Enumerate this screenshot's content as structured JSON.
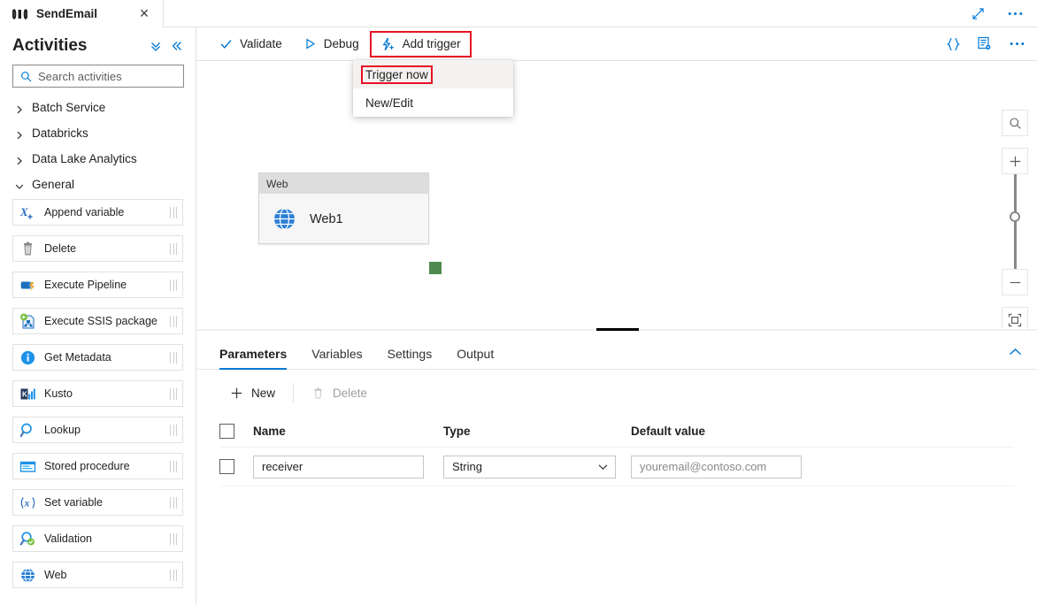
{
  "tab": {
    "icon": "pipeline-icon",
    "title": "SendEmail",
    "close": "✕"
  },
  "window_tools": {
    "maximize": "expand-diagonal-icon",
    "more": "•••"
  },
  "sidebar": {
    "title": "Activities",
    "collapse_all_icon": "double-chevron-down-icon",
    "collapse_panel_icon": "double-chevron-left-icon",
    "search": {
      "placeholder": "Search activities",
      "value": "",
      "icon": "search-icon"
    },
    "categories": [
      {
        "label": "Batch Service",
        "expanded": false
      },
      {
        "label": "Databricks",
        "expanded": false
      },
      {
        "label": "Data Lake Analytics",
        "expanded": false
      },
      {
        "label": "General",
        "expanded": true
      }
    ],
    "activities": [
      {
        "label": "Append variable",
        "icon": "append-variable-icon"
      },
      {
        "label": "Delete",
        "icon": "delete-icon"
      },
      {
        "label": "Execute Pipeline",
        "icon": "execute-pipeline-icon"
      },
      {
        "label": "Execute SSIS package",
        "icon": "execute-ssis-package-icon"
      },
      {
        "label": "Get Metadata",
        "icon": "get-metadata-icon"
      },
      {
        "label": "Kusto",
        "icon": "kusto-icon"
      },
      {
        "label": "Lookup",
        "icon": "lookup-icon"
      },
      {
        "label": "Stored procedure",
        "icon": "stored-procedure-icon"
      },
      {
        "label": "Set variable",
        "icon": "set-variable-icon"
      },
      {
        "label": "Validation",
        "icon": "validation-icon"
      },
      {
        "label": "Web",
        "icon": "web-icon"
      }
    ]
  },
  "toolbar": {
    "validate": {
      "label": "Validate",
      "icon": "checkmark-icon"
    },
    "debug": {
      "label": "Debug",
      "icon": "play-triangle-icon"
    },
    "add_trigger": {
      "label": "Add trigger",
      "icon": "lightning-bolt-plus-icon",
      "highlighted": true
    },
    "code": {
      "icon": "curly-braces-icon"
    },
    "properties": {
      "icon": "properties-list-icon"
    },
    "more": {
      "icon": "ellipsis-icon",
      "label": "•••"
    }
  },
  "trigger_menu": {
    "items": [
      {
        "label": "Trigger now",
        "hovered": true,
        "highlighted": true
      },
      {
        "label": "New/Edit",
        "hovered": false,
        "highlighted": false
      }
    ]
  },
  "canvas": {
    "node": {
      "type_label": "Web",
      "name": "Web1",
      "icon": "globe-icon",
      "output_connector": "success-output-connector"
    },
    "zoom_controls": {
      "search_icon": "zoom-search-icon",
      "zoom_in": "+",
      "zoom_out": "−",
      "fit_icon": "fit-to-screen-icon"
    }
  },
  "bottom_panel": {
    "tabs": [
      {
        "label": "Parameters",
        "active": true
      },
      {
        "label": "Variables",
        "active": false
      },
      {
        "label": "Settings",
        "active": false
      },
      {
        "label": "Output",
        "active": false
      }
    ],
    "collapse_icon": "chevron-up-icon",
    "commands": {
      "new": {
        "label": "New",
        "icon": "plus-icon",
        "disabled": false
      },
      "delete": {
        "label": "Delete",
        "icon": "trash-icon",
        "disabled": true
      }
    },
    "table": {
      "columns": [
        "Name",
        "Type",
        "Default value"
      ],
      "rows": [
        {
          "checked": false,
          "name": "receiver",
          "type": "String",
          "default_value": "youremail@contoso.com"
        }
      ]
    }
  },
  "colors": {
    "accent": "#0078d4",
    "highlight_red": "#e81123",
    "success_green": "#4f8a4f",
    "border": "#e1e1e1"
  }
}
